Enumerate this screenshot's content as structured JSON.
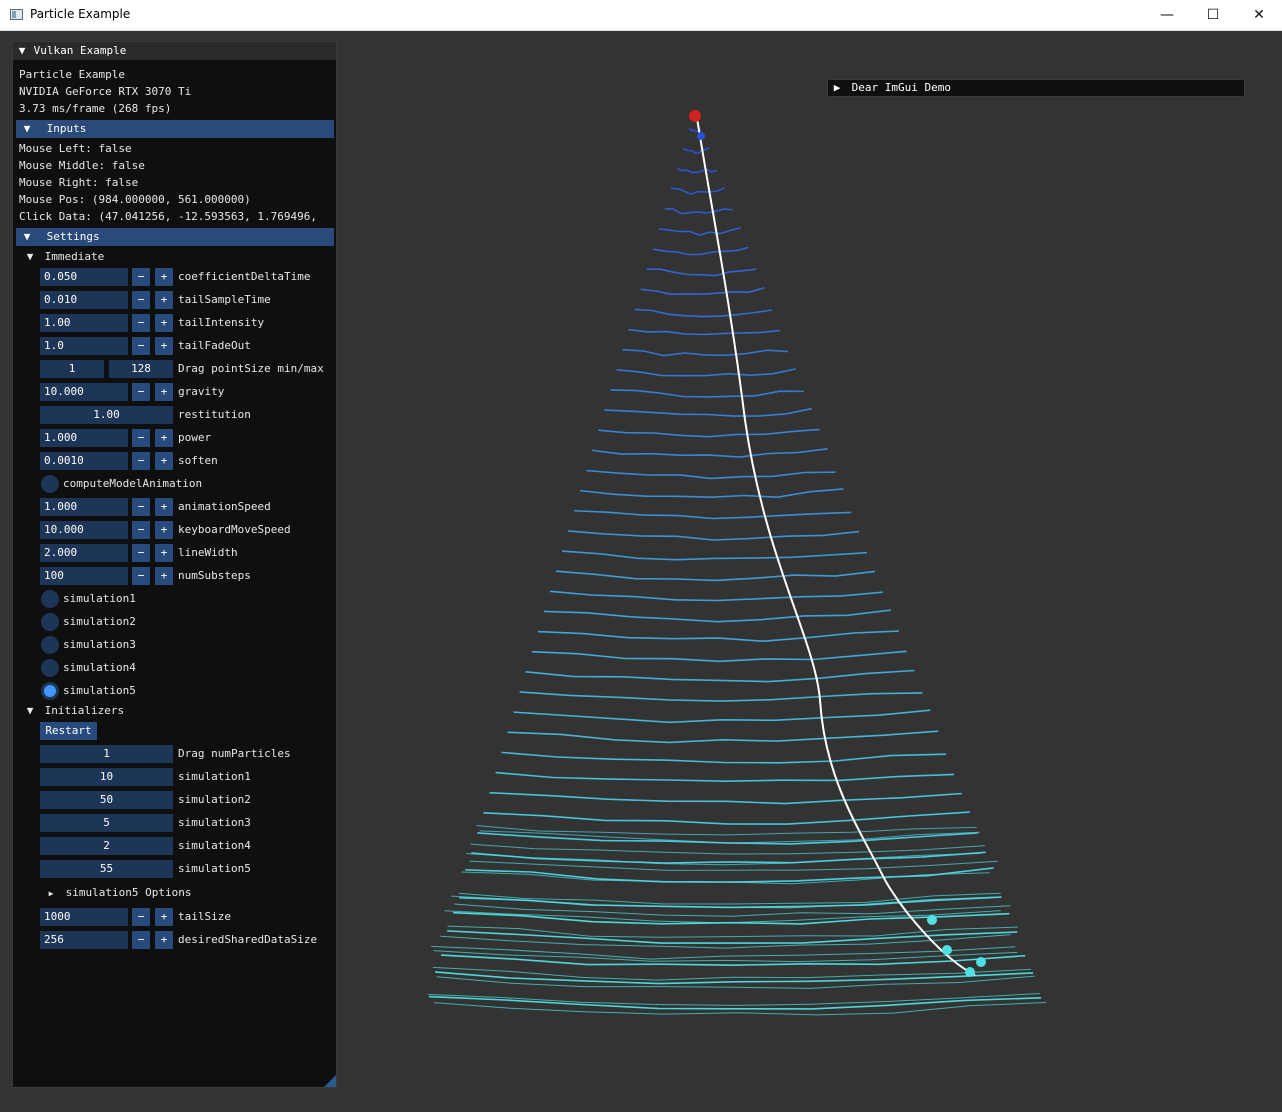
{
  "window": {
    "title": "Particle Example",
    "minimize": "—",
    "maximize": "☐",
    "close": "✕"
  },
  "panel": {
    "title": "Vulkan Example",
    "info": [
      "Particle Example",
      "NVIDIA GeForce RTX 3070 Ti",
      "3.73 ms/frame (268 fps)"
    ],
    "inputs_header": "Inputs",
    "inputs": [
      "Mouse Left: false",
      "Mouse Middle: false",
      "Mouse Right: false",
      "Mouse Pos: (984.000000, 561.000000)",
      "Click Data: (47.041256, -12.593563, 1.769496,"
    ],
    "settings_header": "Settings",
    "immediate_header": "Immediate",
    "minus": "−",
    "plus": "+",
    "steppers_a": [
      {
        "value": "0.050",
        "label": "coefficientDeltaTime"
      },
      {
        "value": "0.010",
        "label": "tailSampleTime"
      },
      {
        "value": "1.00",
        "label": "tailIntensity"
      },
      {
        "value": "1.0",
        "label": "tailFadeOut"
      }
    ],
    "pointsize": {
      "min": "1",
      "max": "128",
      "label": "Drag pointSize min/max"
    },
    "gravity": {
      "value": "10.000",
      "label": "gravity"
    },
    "restitution": {
      "value": "1.00",
      "label": "restitution"
    },
    "steppers_b": [
      {
        "value": "1.000",
        "label": "power"
      },
      {
        "value": "0.0010",
        "label": "soften"
      }
    ],
    "compute_model": "computeModelAnimation",
    "steppers_c": [
      {
        "value": "1.000",
        "label": "animationSpeed"
      },
      {
        "value": "10.000",
        "label": "keyboardMoveSpeed"
      },
      {
        "value": "2.000",
        "label": "lineWidth"
      },
      {
        "value": "100",
        "label": "numSubsteps"
      }
    ],
    "simulations": [
      "simulation1",
      "simulation2",
      "simulation3",
      "simulation4",
      "simulation5"
    ],
    "selected_simulation": "simulation5",
    "initializers_header": "Initializers",
    "restart": "Restart",
    "init_fields": [
      {
        "value": "1",
        "label": "Drag numParticles"
      },
      {
        "value": "10",
        "label": "simulation1"
      },
      {
        "value": "50",
        "label": "simulation2"
      },
      {
        "value": "5",
        "label": "simulation3"
      },
      {
        "value": "2",
        "label": "simulation4"
      },
      {
        "value": "55",
        "label": "simulation5"
      }
    ],
    "sim5_options": "simulation5 Options",
    "steppers_d": [
      {
        "value": "1000",
        "label": "tailSize"
      },
      {
        "value": "256",
        "label": "desiredSharedDataSize"
      }
    ]
  },
  "demo_window": {
    "title": "Dear ImGui Demo"
  },
  "colors": {
    "header": "#294a7a",
    "field": "#1d3557",
    "button": "#264b7c",
    "radio_active": "#4296fa",
    "particle_top": "#2a4fd8",
    "particle_bottom": "#4fe0e6",
    "tip": "#d02020"
  }
}
